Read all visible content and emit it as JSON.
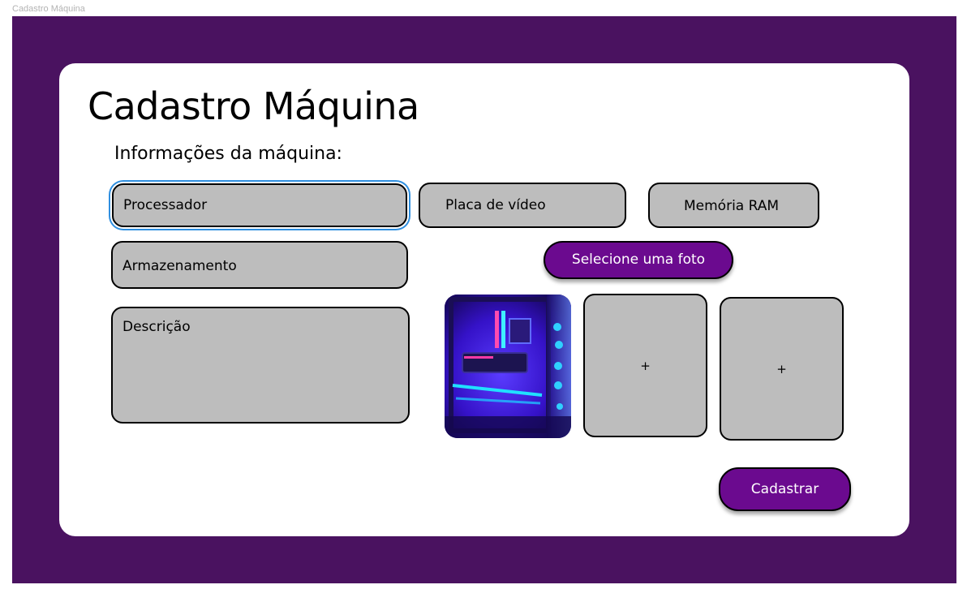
{
  "frame": {
    "label": "Cadastro Máquina"
  },
  "page": {
    "title": "Cadastro Máquina",
    "section_title": "Informações da máquina:"
  },
  "form": {
    "processor_placeholder": "Processador",
    "gpu_placeholder": "Placa de vídeo",
    "ram_placeholder": "Memória RAM",
    "storage_placeholder": "Armazenamento",
    "description_placeholder": "Descrição"
  },
  "photos": {
    "select_label": "Selecione uma foto",
    "add_slot_symbol": "+",
    "thumbnail_icon": "pc-case-photo"
  },
  "actions": {
    "submit_label": "Cadastrar"
  },
  "colors": {
    "background": "#4a1260",
    "card": "#ffffff",
    "field": "#bdbdbd",
    "accent": "#6b0a8f",
    "focus_ring": "#2f8fe0"
  }
}
